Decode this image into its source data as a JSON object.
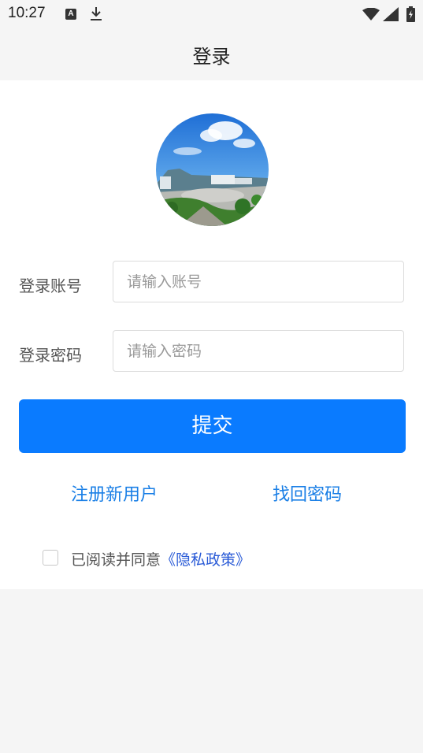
{
  "status_bar": {
    "time": "10:27",
    "a_icon_letter": "A",
    "icons": [
      "a-icon",
      "download-icon",
      "wifi-icon",
      "signal-icon",
      "battery-icon"
    ]
  },
  "header": {
    "title": "登录"
  },
  "form": {
    "account_label": "登录账号",
    "account_placeholder": "请输入账号",
    "account_value": "",
    "password_label": "登录密码",
    "password_placeholder": "请输入密码",
    "password_value": "",
    "submit_label": "提交"
  },
  "links": {
    "register": "注册新用户",
    "recover_password": "找回密码"
  },
  "agreement": {
    "checked": false,
    "text": "已阅读并同意",
    "policy": "《隐私政策》"
  },
  "colors": {
    "primary": "#0a7bff",
    "link": "#1a7fe6",
    "policy_link": "#2a5bd7",
    "background": "#f5f5f5"
  }
}
